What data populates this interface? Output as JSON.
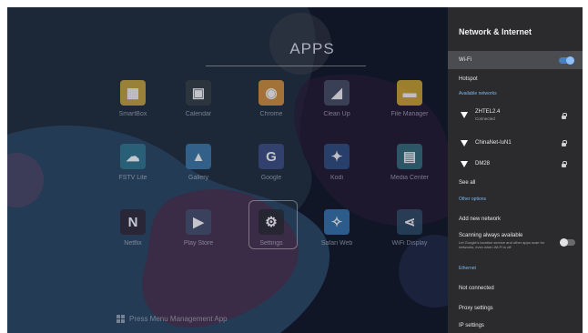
{
  "launcher": {
    "title": "APPS",
    "apps": [
      {
        "name": "SmartBox",
        "icon": "folder-app-icon",
        "color": "#c9a43a",
        "glyph": "▦"
      },
      {
        "name": "Calendar",
        "icon": "calculator-app-icon",
        "color": "#333a40",
        "glyph": "▣"
      },
      {
        "name": "Chrome",
        "icon": "chrome-app-icon",
        "color": "#d8903a",
        "glyph": "◉"
      },
      {
        "name": "Clean Up",
        "icon": "broom-app-icon",
        "color": "#445066",
        "glyph": "◢"
      },
      {
        "name": "File Manager",
        "icon": "file-manager-app-icon",
        "color": "#d2a830",
        "glyph": "▬"
      },
      {
        "name": "FSTV Lite",
        "icon": "cloud-app-icon",
        "color": "#2c6f86",
        "glyph": "☁"
      },
      {
        "name": "Gallery",
        "icon": "gallery-app-icon",
        "color": "#3b77a8",
        "glyph": "▲"
      },
      {
        "name": "Google",
        "icon": "google-app-icon",
        "color": "#3a4a82",
        "glyph": "G"
      },
      {
        "name": "Kodi",
        "icon": "kodi-app-icon",
        "color": "#2d4f82",
        "glyph": "✦"
      },
      {
        "name": "Media Center",
        "icon": "media-center-app-icon",
        "color": "#2f6f7a",
        "glyph": "▤"
      },
      {
        "name": "Netflix",
        "icon": "netflix-app-icon",
        "color": "#2a1f2c",
        "glyph": "N"
      },
      {
        "name": "Play Store",
        "icon": "play-store-app-icon",
        "color": "#3a4a66",
        "glyph": "▶"
      },
      {
        "name": "Settings",
        "icon": "settings-app-icon",
        "color": "#1f252c",
        "glyph": "⚙"
      },
      {
        "name": "Safari Web",
        "icon": "compass-app-icon",
        "color": "#3577b4",
        "glyph": "✧"
      },
      {
        "name": "WiFi Display",
        "icon": "share-app-icon",
        "color": "#2c4a66",
        "glyph": "⋖"
      }
    ],
    "bottom_link": "Press Menu Management App"
  },
  "panel": {
    "title": "Network & Internet",
    "wifi_label": "Wi-Fi",
    "wifi_on": true,
    "hotspot": "Hotspot",
    "available_header": "Available networks",
    "networks": [
      {
        "name": "ZHTEL2.4",
        "status": "Connected"
      },
      {
        "name": "ChinaNet-IuN1",
        "status": ""
      },
      {
        "name": "DM28",
        "status": ""
      }
    ],
    "see_all": "See all",
    "other_header": "Other options",
    "add_network": "Add new network",
    "scanning_label": "Scanning always available",
    "scanning_desc": "Let Google's location service and other apps scan for networks, even when Wi-Fi is off",
    "scanning_on": false,
    "ethernet_header": "Ethernet",
    "ethernet_status": "Not connected",
    "proxy": "Proxy settings",
    "ip": "IP settings"
  },
  "colors": {
    "accent": "#7ab7ef",
    "panel_bg": "#2b2b2d",
    "selected_row": "#4b4c50"
  }
}
